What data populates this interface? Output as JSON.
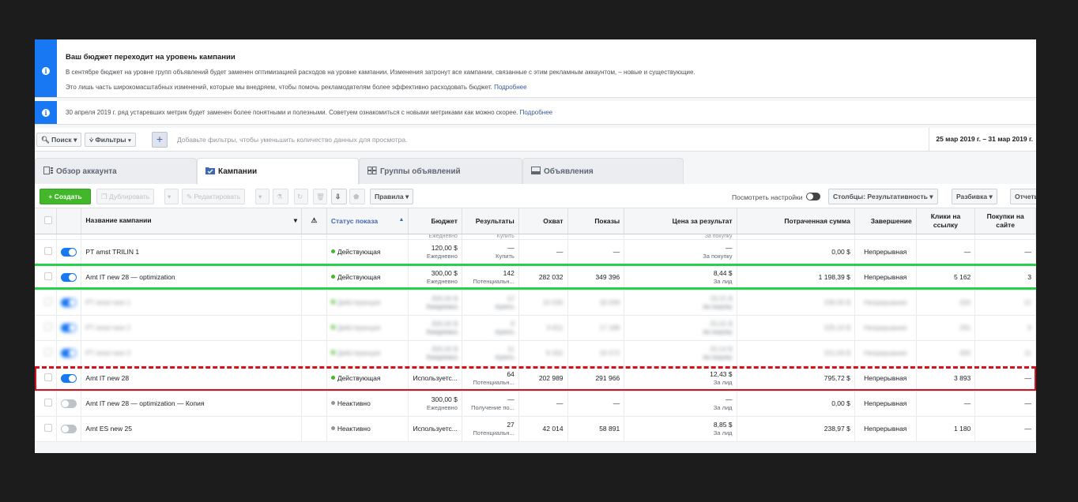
{
  "notices": [
    {
      "title": "Ваш бюджет переходит на уровень кампании",
      "line1": "В сентябре бюджет на уровне групп объявлений будет заменен оптимизацией расходов на уровне кампании. Изменения затронут все кампании, связанные с этим рекламным аккаунтом, – новые и существующие.",
      "line2": "Это лишь часть широкомасштабных изменений, которые мы внедряем, чтобы помочь рекламодателям более эффективно расходовать бюджет.",
      "link": "Подробнее"
    },
    {
      "line1": "30 апреля 2019 г. ряд устаревших метрик будет заменен более понятными и полезными. Советуем ознакомиться с новыми метриками как можно скорее.",
      "link": "Подробнее"
    }
  ],
  "filterbar": {
    "search_label": "Поиск",
    "filters_label": "Фильтры",
    "add_label": "+",
    "hint": "Добавьте фильтры, чтобы уменьшить количество данных для просмотра.",
    "date_range": "25 мар 2019 г. – 31 мар 2019 г."
  },
  "tabs": [
    {
      "label": "Обзор аккаунта",
      "icon": "account-overview-icon"
    },
    {
      "label": "Кампании",
      "icon": "folder-icon"
    },
    {
      "label": "Группы объявлений",
      "icon": "grid-icon"
    },
    {
      "label": "Объявления",
      "icon": "ad-icon"
    }
  ],
  "toolbar": {
    "create_label": "+  Создать",
    "duplicate_label": "Дублировать",
    "edit_label": "Редактировать",
    "rules_label": "Правила",
    "view_settings_label": "Посмотреть настройки",
    "columns_label": "Столбцы: Результативность",
    "breakdown_label": "Разбивка",
    "reports_label": "Отчеты"
  },
  "columns": [
    "Название кампании",
    "Статус показа",
    "Бюджет",
    "Результаты",
    "Охват",
    "Показы",
    "Цена за результат",
    "Потраченная сумма",
    "Завершение",
    "Клики на ссылку",
    "Покупки на сайте"
  ],
  "partial_row": {
    "budget_sub": "Ежедневно",
    "results_sub": "Купить",
    "cpr_sub": "За покупку"
  },
  "rows": [
    {
      "name": "PT amst TRILIN 1",
      "toggle": "on",
      "status": "Действующая",
      "status_color": "#42b72a",
      "budget": "120,00 $",
      "budget_sub": "Ежедневно",
      "results": "—",
      "results_sub": "Купить",
      "reach": "—",
      "impressions": "—",
      "cpr": "—",
      "cpr_sub": "За покупку",
      "spent": "0,00 $",
      "ends": "Непрерывная",
      "clicks": "—",
      "purchases": "—"
    },
    {
      "name": "Amt IT new 28 — optimization",
      "toggle": "on",
      "status": "Действующая",
      "status_color": "#42b72a",
      "budget": "300,00 $",
      "budget_sub": "Ежедневно",
      "results": "142",
      "results_sub": "Потенциальн...",
      "reach": "282 032",
      "impressions": "349 396",
      "cpr": "8,44 $",
      "cpr_sub": "За лид",
      "spent": "1 198,39 $",
      "ends": "Непрерывная",
      "clicks": "5 162",
      "purchases": "3"
    },
    {
      "name": "PT amst new 1",
      "toggle": "on",
      "status": "Действующая",
      "status_color": "#42b72a",
      "budget": "300,00 $",
      "budget_sub": "Ежедневно",
      "results": "12",
      "results_sub": "Купить",
      "reach": "10 030",
      "impressions": "18 009",
      "cpr": "19,21 $",
      "cpr_sub": "За покупку",
      "spent": "230,50 $",
      "ends": "Непрерывная",
      "clicks": "320",
      "purchases": "12"
    },
    {
      "name": "PT amst new 2",
      "toggle": "on",
      "status": "Действующая",
      "status_color": "#42b72a",
      "budget": "300,00 $",
      "budget_sub": "Ежедневно",
      "results": "9",
      "results_sub": "Купить",
      "reach": "9 811",
      "impressions": "17 188",
      "cpr": "25,01 $",
      "cpr_sub": "За покупку",
      "spent": "225,10 $",
      "ends": "Непрерывная",
      "clicks": "291",
      "purchases": "9"
    },
    {
      "name": "PT amst new 3",
      "toggle": "on",
      "status": "Действующая",
      "status_color": "#42b72a",
      "budget": "300,00 $",
      "budget_sub": "Ежедневно",
      "results": "11",
      "results_sub": "Купить",
      "reach": "8 302",
      "impressions": "16 572",
      "cpr": "20,14 $",
      "cpr_sub": "За покупку",
      "spent": "221,56 $",
      "ends": "Непрерывная",
      "clicks": "305",
      "purchases": "11"
    },
    {
      "name": "Amt IT new 28",
      "toggle": "on",
      "status": "Действующая",
      "status_color": "#42b72a",
      "budget": "Используетс...",
      "budget_sub": "",
      "results": "64",
      "results_sub": "Потенциальн...",
      "reach": "202 989",
      "impressions": "291 966",
      "cpr": "12,43 $",
      "cpr_sub": "За лид",
      "spent": "795,72 $",
      "ends": "Непрерывная",
      "clicks": "3 893",
      "purchases": "—"
    },
    {
      "name": "Amt IT new 28 — optimization — Копия",
      "toggle": "off",
      "status": "Неактивно",
      "status_color": "#90949c",
      "budget": "300,00 $",
      "budget_sub": "Ежедневно",
      "results": "—",
      "results_sub": "Получение по...",
      "reach": "—",
      "impressions": "—",
      "cpr": "—",
      "cpr_sub": "За лид",
      "spent": "0,00 $",
      "ends": "Непрерывная",
      "clicks": "—",
      "purchases": "—"
    },
    {
      "name": "Amt ES new 25",
      "toggle": "off",
      "status": "Неактивно",
      "status_color": "#90949c",
      "budget": "Используетс...",
      "budget_sub": "",
      "results": "27",
      "results_sub": "Потенциальн...",
      "reach": "42 014",
      "impressions": "58 891",
      "cpr": "8,85 $",
      "cpr_sub": "За лид",
      "spent": "238,97 $",
      "ends": "Непрерывная",
      "clicks": "1 180",
      "purchases": "—"
    }
  ],
  "highlights": {
    "green": "#29d14b",
    "red": "#d0131c"
  },
  "colors": {
    "brand": "#1877f2",
    "create": "#42b72a",
    "link": "#385898"
  }
}
